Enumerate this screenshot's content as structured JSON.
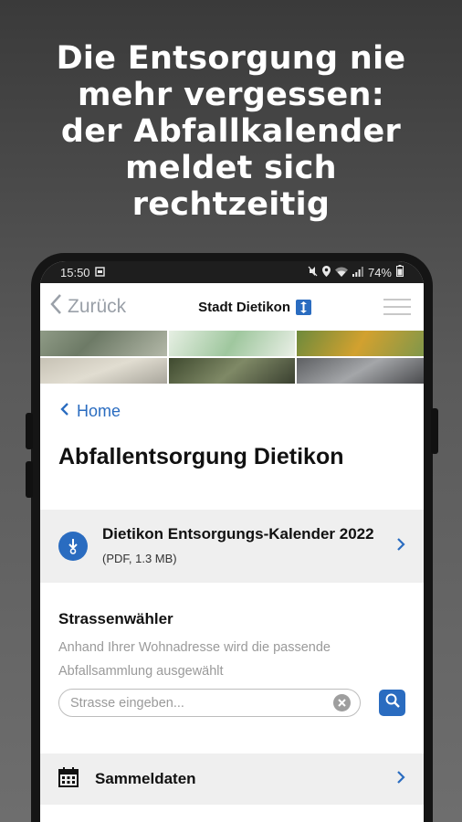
{
  "promo": {
    "lines": [
      "Die Entsorgung nie",
      "mehr vergessen:",
      "der Abfallkalender",
      "meldet sich",
      "rechtzeitig"
    ]
  },
  "statusbar": {
    "time": "15:50",
    "battery": "74%"
  },
  "navbar": {
    "back_label": "Zurück",
    "brand": "Stadt Dietikon",
    "menu_icon": "hamburger-icon"
  },
  "breadcrumb": {
    "home_label": "Home"
  },
  "page": {
    "title": "Abfallentsorgung Dietikon"
  },
  "download": {
    "title": "Dietikon Entsorgungs-Kalender 2022",
    "meta": "(PDF, 1.3 MB)",
    "icon": "download-icon"
  },
  "street_picker": {
    "heading": "Strassenwähler",
    "description": "Anhand Ihrer Wohnadresse wird die passende Abfallsammlung ausgewählt",
    "placeholder": "Strasse eingeben...",
    "search_icon": "search-icon",
    "clear_icon": "clear-icon"
  },
  "collection": {
    "label": "Sammeldaten",
    "icon": "calendar-icon"
  },
  "colors": {
    "accent": "#2a6cc0",
    "row_bg": "#efefef"
  }
}
